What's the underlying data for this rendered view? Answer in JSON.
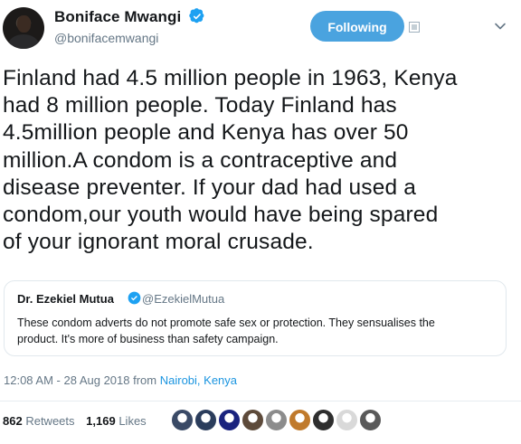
{
  "author": {
    "name": "Boniface Mwangi",
    "handle": "@bonifacemwangi",
    "verified": true
  },
  "follow_button": {
    "label": "Following",
    "color": "#4aa3df"
  },
  "tweet": {
    "lines": [
      "Finland had 4.5 million people in 1963, Kenya",
      "had 8 million people. Today Finland has",
      "4.5million people and Kenya has over 50",
      "million.A condom is a contraceptive and",
      "disease preventer. If your dad had used a",
      "condom,our youth would have being spared",
      "of your ignorant moral crusade."
    ]
  },
  "quoted_tweet": {
    "name": "Dr. Ezekiel Mutua",
    "handle": "@EzekielMutua",
    "verified": true,
    "lines": [
      "These condom adverts do not promote safe sex or protection. They sensualises the",
      "product. It's more of business than safety campaign."
    ]
  },
  "meta": {
    "timestamp": "12:08 AM - 28 Aug 2018 from ",
    "location": "Nairobi, Kenya"
  },
  "stats": {
    "retweets_count": "862",
    "retweets_label": "Retweets",
    "likes_count": "1,169",
    "likes_label": "Likes"
  },
  "likers": [
    {
      "name": "liker-avatar-1",
      "color": "#3a4a66"
    },
    {
      "name": "liker-avatar-2",
      "color": "#2b3d5c"
    },
    {
      "name": "liker-avatar-3",
      "color": "#1a237e"
    },
    {
      "name": "liker-avatar-4",
      "color": "#5d4a3a"
    },
    {
      "name": "liker-avatar-5",
      "color": "#8c8c8c"
    },
    {
      "name": "liker-avatar-6",
      "color": "#c07a2c"
    },
    {
      "name": "liker-avatar-7",
      "color": "#2e2e2e"
    },
    {
      "name": "liker-avatar-8",
      "color": "#d9d9d9"
    },
    {
      "name": "liker-avatar-9",
      "color": "#5a5a5a"
    }
  ],
  "colors": {
    "accent": "#1da1f2",
    "muted": "#657786",
    "text": "#14171a"
  },
  "icons": {
    "verified": "verified-badge-icon",
    "notify": "notification-square-icon",
    "more": "chevron-down-icon"
  }
}
